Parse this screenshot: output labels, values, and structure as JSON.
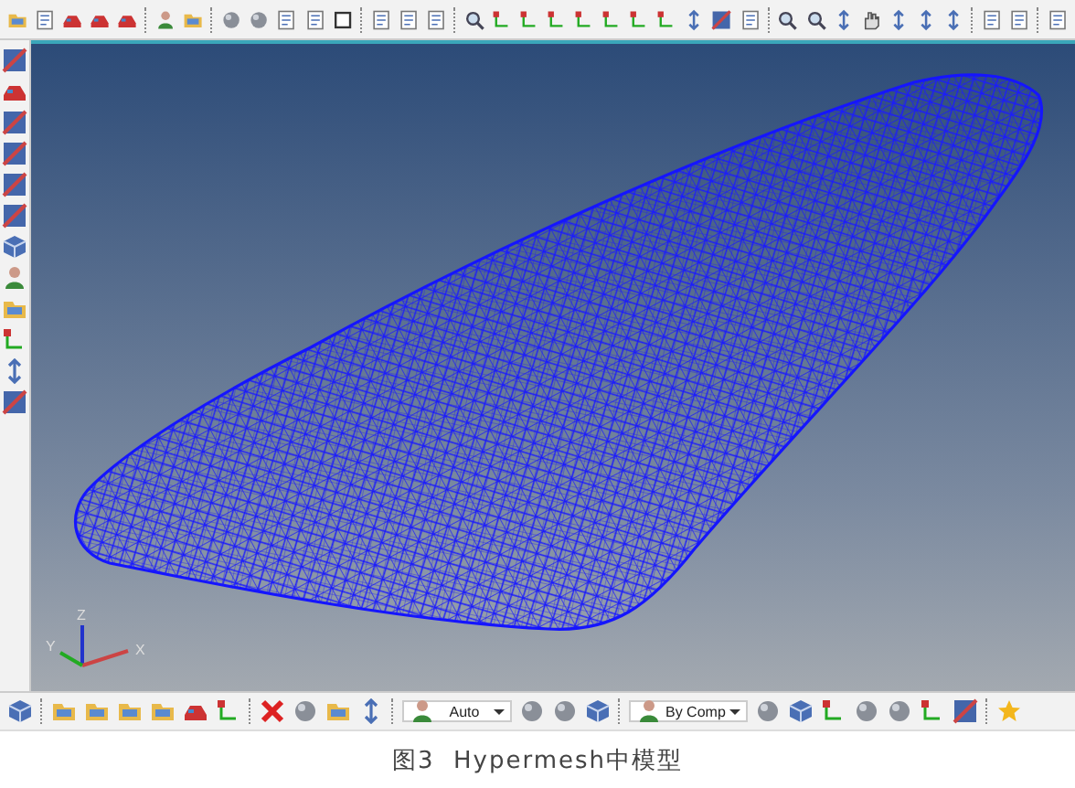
{
  "axis_triad": {
    "labels": [
      "X",
      "Y",
      "Z"
    ]
  },
  "bottom_toolbar": {
    "dropdowns": [
      {
        "value": "Auto"
      },
      {
        "value": "By Comp"
      }
    ]
  },
  "caption": "图3  Hypermesh中模型"
}
